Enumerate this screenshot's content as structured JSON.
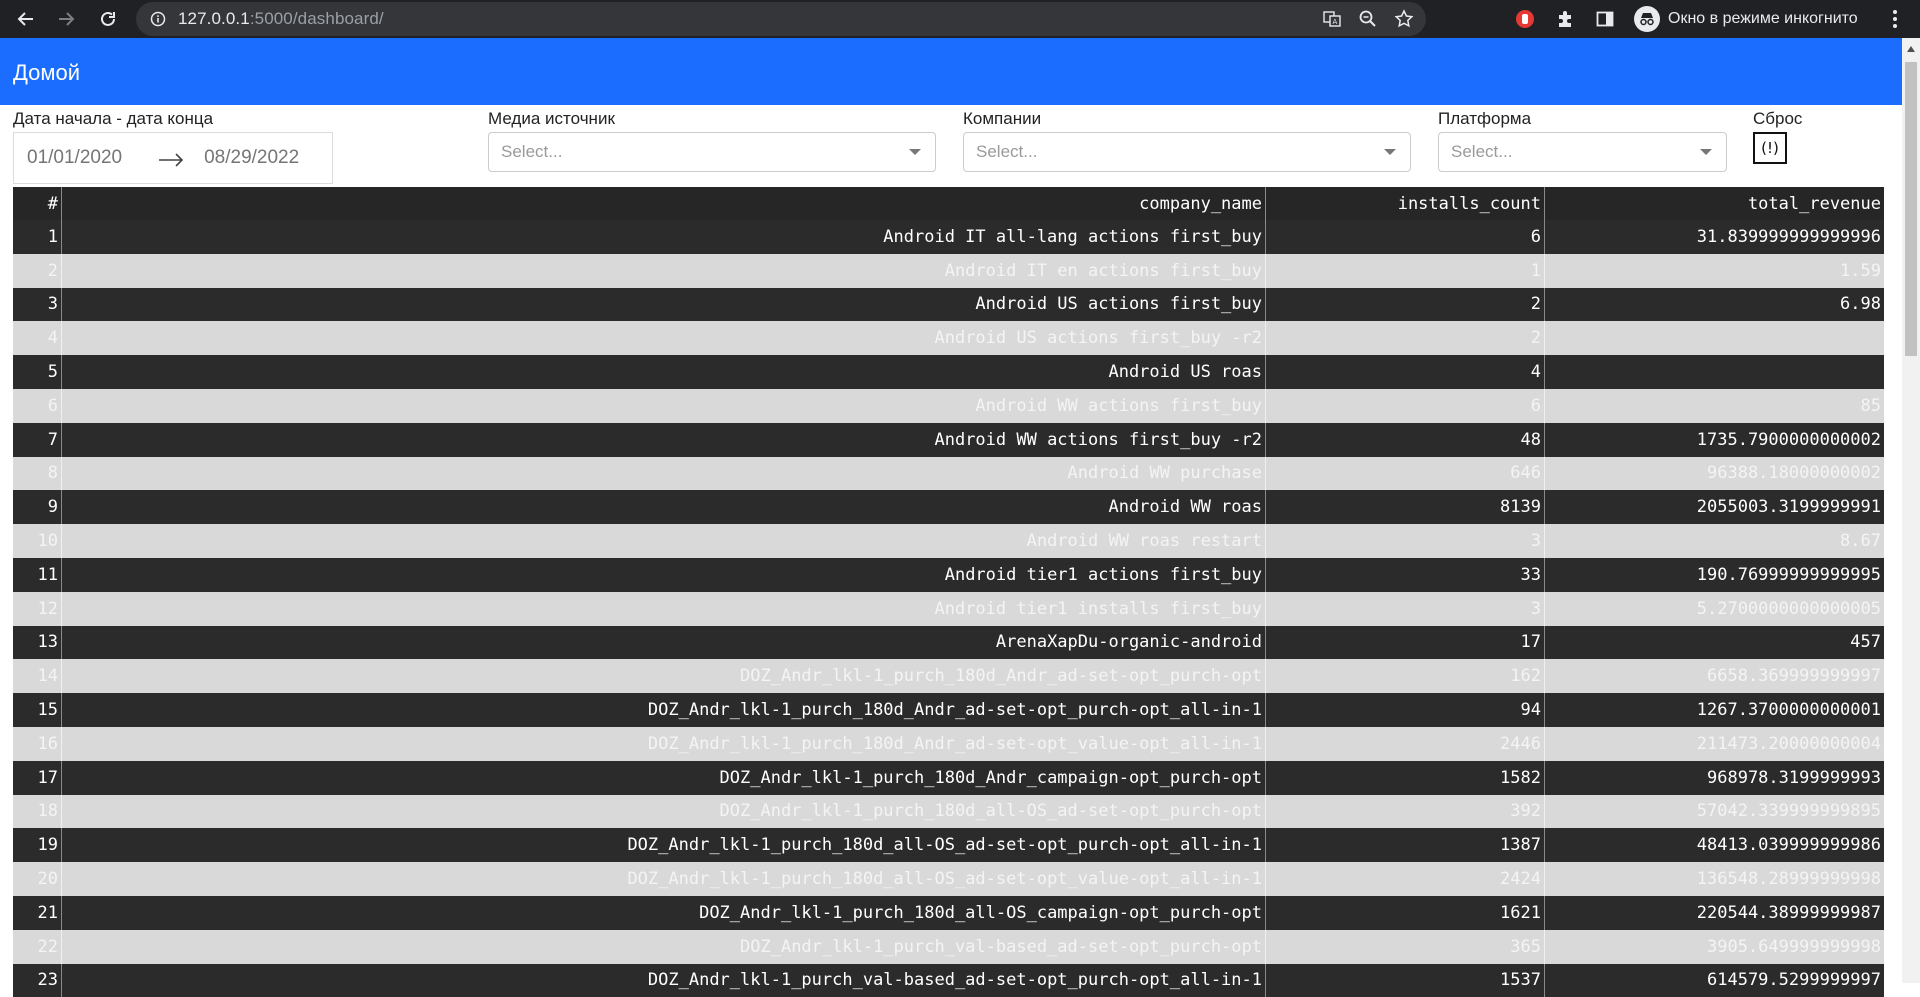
{
  "browser": {
    "url_host": "127.0.0.1",
    "url_rest": ":5000/dashboard/",
    "incognito_label": "Окно в режиме инкогнито"
  },
  "header": {
    "title": "Домой"
  },
  "filters": {
    "date_label": "Дата начала - дата конца",
    "date_start": "01/01/2020",
    "date_end": "08/29/2022",
    "media_label": "Медиа источник",
    "media_placeholder": "Select...",
    "company_label": "Компании",
    "company_placeholder": "Select...",
    "platform_label": "Платформа",
    "platform_placeholder": "Select...",
    "reset_label": "Сброс",
    "reset_button": "(!)"
  },
  "table": {
    "columns": [
      "#",
      "company_name",
      "installs_count",
      "total_revenue"
    ],
    "rows": [
      [
        "1",
        "Android IT all-lang actions first_buy",
        "6",
        "31.839999999999996"
      ],
      [
        "2",
        "Android IT en actions first_buy",
        "1",
        "1.59"
      ],
      [
        "3",
        "Android US actions first_buy",
        "2",
        "6.98"
      ],
      [
        "4",
        "Android US actions first_buy -r2",
        "2",
        ""
      ],
      [
        "5",
        "Android US roas",
        "4",
        ""
      ],
      [
        "6",
        "Android WW actions first_buy",
        "6",
        "85"
      ],
      [
        "7",
        "Android WW actions first_buy -r2",
        "48",
        "1735.7900000000002"
      ],
      [
        "8",
        "Android WW purchase",
        "646",
        "96388.18000000002"
      ],
      [
        "9",
        "Android WW roas",
        "8139",
        "2055003.3199999991"
      ],
      [
        "10",
        "Android WW roas restart",
        "3",
        "8.67"
      ],
      [
        "11",
        "Android tier1 actions first_buy",
        "33",
        "190.76999999999995"
      ],
      [
        "12",
        "Android tier1 installs first_buy",
        "3",
        "5.2700000000000005"
      ],
      [
        "13",
        "ArenaXapDu-organic-android",
        "17",
        "457"
      ],
      [
        "14",
        "DOZ_Andr_lkl-1_purch_180d_Andr_ad-set-opt_purch-opt",
        "162",
        "6658.369999999997"
      ],
      [
        "15",
        "DOZ_Andr_lkl-1_purch_180d_Andr_ad-set-opt_purch-opt_all-in-1",
        "94",
        "1267.3700000000001"
      ],
      [
        "16",
        "DOZ_Andr_lkl-1_purch_180d_Andr_ad-set-opt_value-opt_all-in-1",
        "2446",
        "211473.20000000004"
      ],
      [
        "17",
        "DOZ_Andr_lkl-1_purch_180d_Andr_campaign-opt_purch-opt",
        "1582",
        "968978.3199999993"
      ],
      [
        "18",
        "DOZ_Andr_lkl-1_purch_180d_all-OS_ad-set-opt_purch-opt",
        "392",
        "57042.339999999895"
      ],
      [
        "19",
        "DOZ_Andr_lkl-1_purch_180d_all-OS_ad-set-opt_purch-opt_all-in-1",
        "1387",
        "48413.039999999986"
      ],
      [
        "20",
        "DOZ_Andr_lkl-1_purch_180d_all-OS_ad-set-opt_value-opt_all-in-1",
        "2424",
        "136548.28999999998"
      ],
      [
        "21",
        "DOZ_Andr_lkl-1_purch_180d_all-OS_campaign-opt_purch-opt",
        "1621",
        "220544.38999999987"
      ],
      [
        "22",
        "DOZ_Andr_lkl-1_purch_val-based_ad-set-opt_purch-opt",
        "365",
        "3905.649999999998"
      ],
      [
        "23",
        "DOZ_Andr_lkl-1_purch_val-based_ad-set-opt_purch-opt_all-in-1",
        "1537",
        "614579.5299999997"
      ]
    ]
  }
}
